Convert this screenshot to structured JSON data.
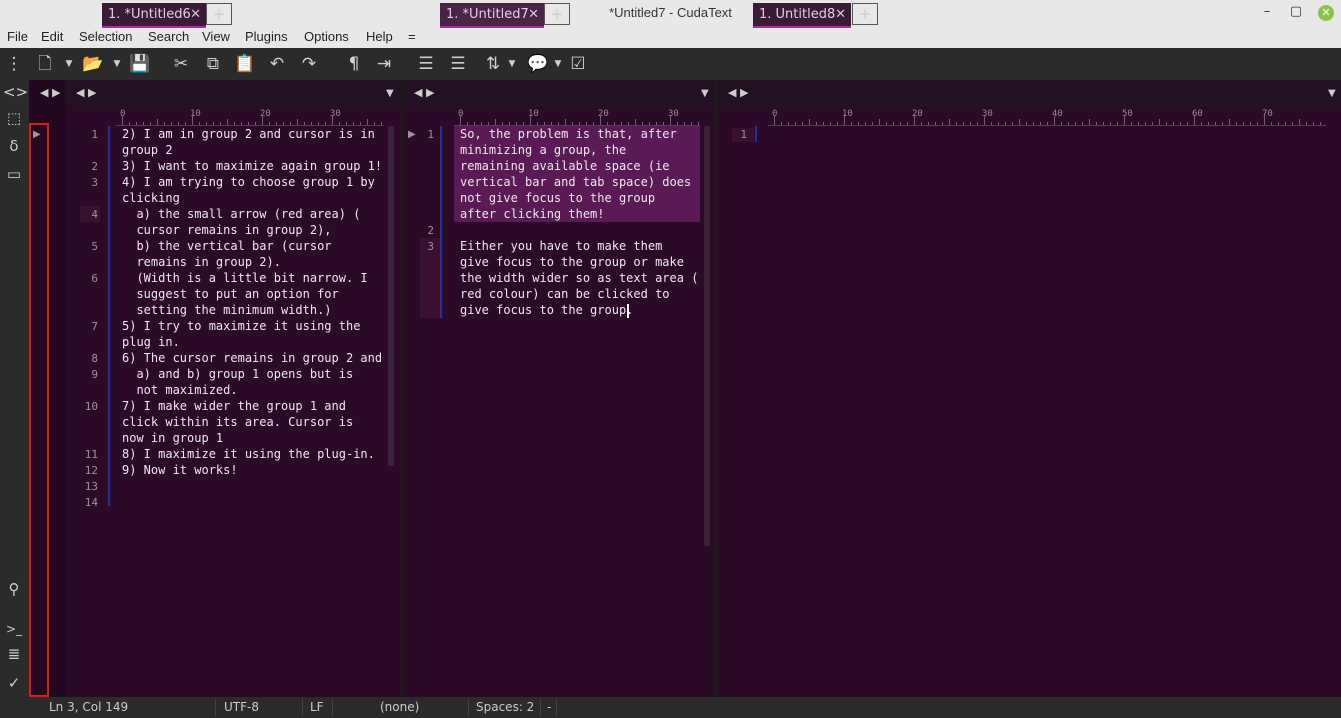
{
  "window": {
    "title": "*Untitled7 - CudaText",
    "minimize": "–",
    "maximize": "▢",
    "close": "✕"
  },
  "menu": [
    "File",
    "Edit",
    "Selection",
    "Search",
    "View",
    "Plugins",
    "Options",
    "Help",
    "="
  ],
  "groups": [
    {
      "tab": "1. *Untitled6",
      "ruler_labels": [
        "0",
        "10",
        "20",
        "30"
      ],
      "lines": [
        {
          "n": "1",
          "text": "2) I am in group 2 and cursor is in"
        },
        {
          "n": "",
          "text": "group 2"
        },
        {
          "n": "2",
          "text": "3) I want to maximize again group 1!"
        },
        {
          "n": "3",
          "text": "4) I am trying to choose group 1 by"
        },
        {
          "n": "",
          "text": "clicking"
        },
        {
          "n": "4",
          "text": "  a) the small arrow (red area) ("
        },
        {
          "n": "",
          "text": "  cursor remains in group 2),"
        },
        {
          "n": "5",
          "text": "  b) the vertical bar (cursor"
        },
        {
          "n": "",
          "text": "  remains in group 2)."
        },
        {
          "n": "6",
          "text": "  (Width is a little bit narrow. I"
        },
        {
          "n": "",
          "text": "  suggest to put an option for"
        },
        {
          "n": "",
          "text": "  setting the minimum width.)"
        },
        {
          "n": "7",
          "text": "5) I try to maximize it using the"
        },
        {
          "n": "",
          "text": "plug in."
        },
        {
          "n": "8",
          "text": "6) The cursor remains in group 2 and"
        },
        {
          "n": "9",
          "text": "  a) and b) group 1 opens but is"
        },
        {
          "n": "",
          "text": "  not maximized."
        },
        {
          "n": "10",
          "text": "7) I make wider the group 1 and"
        },
        {
          "n": "",
          "text": "click within its area. Cursor is"
        },
        {
          "n": "",
          "text": "now in group 1"
        },
        {
          "n": "11",
          "text": "8) I maximize it using the plug-in."
        },
        {
          "n": "12",
          "text": "9) Now it works!"
        },
        {
          "n": "13",
          "text": ""
        },
        {
          "n": "14",
          "text": ""
        }
      ]
    },
    {
      "tab": "1. *Untitled7",
      "ruler_labels": [
        "0",
        "10",
        "20",
        "30"
      ],
      "lines": [
        {
          "n": "1",
          "text": "So, the problem is that, after"
        },
        {
          "n": "",
          "text": "minimizing a group, the"
        },
        {
          "n": "",
          "text": "remaining available space (ie"
        },
        {
          "n": "",
          "text": "vertical bar and tab space) does"
        },
        {
          "n": "",
          "text": "not give focus to the group"
        },
        {
          "n": "",
          "text": "after clicking them!"
        },
        {
          "n": "2",
          "text": ""
        },
        {
          "n": "3",
          "text": "Either you have to make them"
        },
        {
          "n": "",
          "text": "give focus to the group or make"
        },
        {
          "n": "",
          "text": "the width wider so as text area ("
        },
        {
          "n": "",
          "text": "red colour) can be clicked to"
        },
        {
          "n": "",
          "text": "give focus to the group."
        }
      ]
    },
    {
      "tab": "1. Untitled8",
      "ruler_labels": [
        "0",
        "10",
        "20",
        "30",
        "40",
        "50",
        "60",
        "70"
      ],
      "lines": [
        {
          "n": "1",
          "text": ""
        }
      ]
    }
  ],
  "status": {
    "position": "Ln 3, Col 149",
    "encoding": "UTF-8",
    "line_ending": "LF",
    "lexer": "(none)",
    "indent": "Spaces: 2",
    "extra": "-"
  },
  "colors": {
    "editor_bg": "#2a0a26",
    "selection": "#5a1a55",
    "highlight_box": "#e01818"
  }
}
